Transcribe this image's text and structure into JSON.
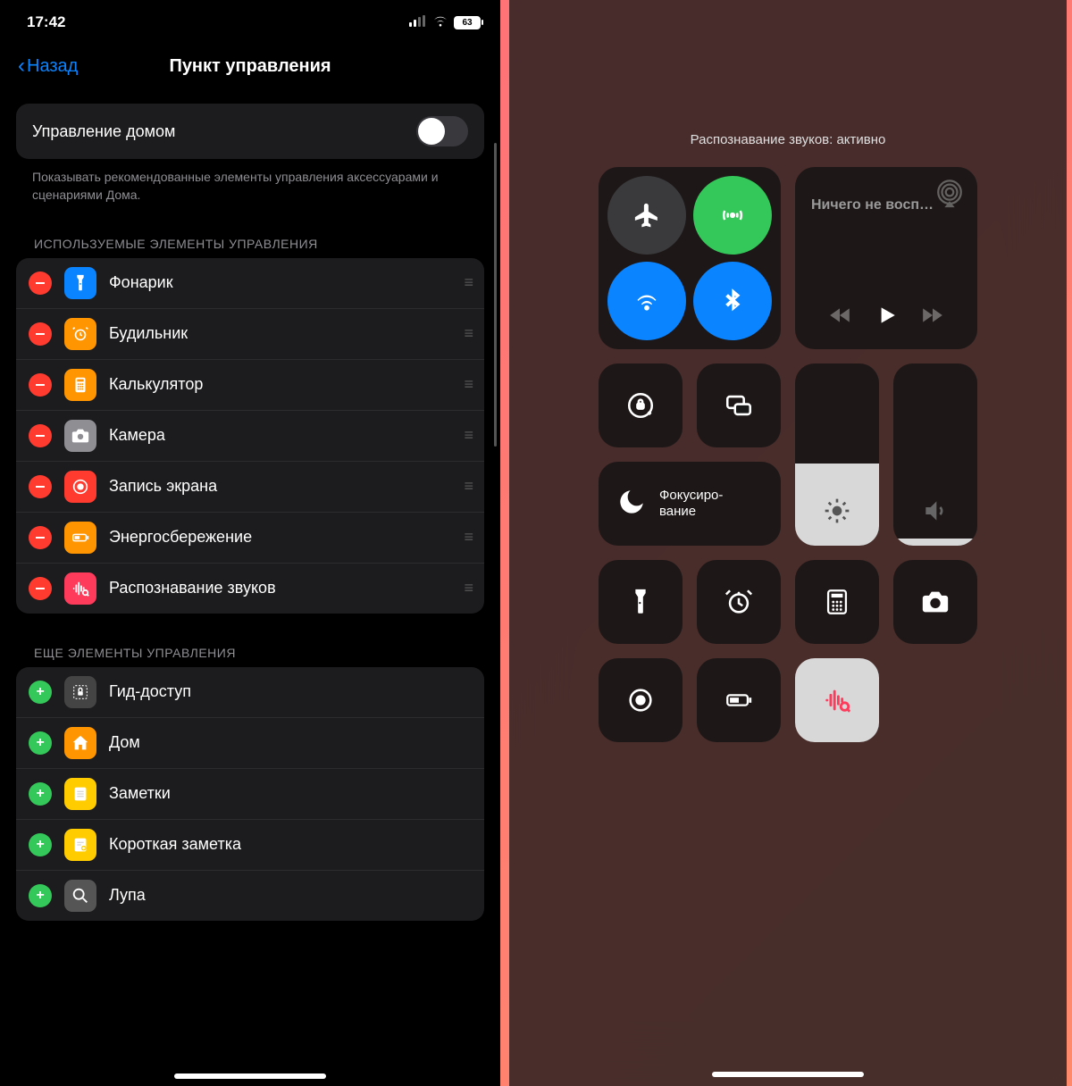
{
  "left": {
    "status": {
      "time": "17:42",
      "battery": "63"
    },
    "nav": {
      "back": "Назад",
      "title": "Пункт управления"
    },
    "toggle": {
      "label": "Управление домом",
      "helper": "Показывать рекомендованные элементы управления аксессуарами и сценариями Дома."
    },
    "sections": {
      "used_header": "ИСПОЛЬЗУЕМЫЕ ЭЛЕМЕНТЫ УПРАВЛЕНИЯ",
      "more_header": "ЕЩЕ ЭЛЕМЕНТЫ УПРАВЛЕНИЯ"
    },
    "used": [
      {
        "label": "Фонарик",
        "icon": "flashlight",
        "color": "#0a84ff"
      },
      {
        "label": "Будильник",
        "icon": "alarm",
        "color": "#ff9500"
      },
      {
        "label": "Калькулятор",
        "icon": "calculator",
        "color": "#ff9500"
      },
      {
        "label": "Камера",
        "icon": "camera",
        "color": "#8e8e93"
      },
      {
        "label": "Запись экрана",
        "icon": "record",
        "color": "#ff3b30"
      },
      {
        "label": "Энергосбережение",
        "icon": "battery",
        "color": "#ff9500"
      },
      {
        "label": "Распознавание звуков",
        "icon": "sound-recog",
        "color": "#ff3b5c"
      }
    ],
    "more": [
      {
        "label": "Гид-доступ",
        "icon": "lock-frame",
        "color": "#444"
      },
      {
        "label": "Дом",
        "icon": "home",
        "color": "#ff9500"
      },
      {
        "label": "Заметки",
        "icon": "notes",
        "color": "#ffcc00"
      },
      {
        "label": "Короткая заметка",
        "icon": "quick-note",
        "color": "#ffcc00"
      },
      {
        "label": "Лупа",
        "icon": "magnifier",
        "color": "#555"
      }
    ]
  },
  "right": {
    "status_text": "Распознавание звуков: активно",
    "media": {
      "title": "Ничего не восп…"
    },
    "focus": {
      "label": "Фокусиро-\nвание"
    },
    "brightness_pct": 45,
    "volume_pct": 4,
    "connectivity": {
      "airplane": false,
      "cellular": true,
      "wifi": true,
      "bluetooth": true
    }
  }
}
